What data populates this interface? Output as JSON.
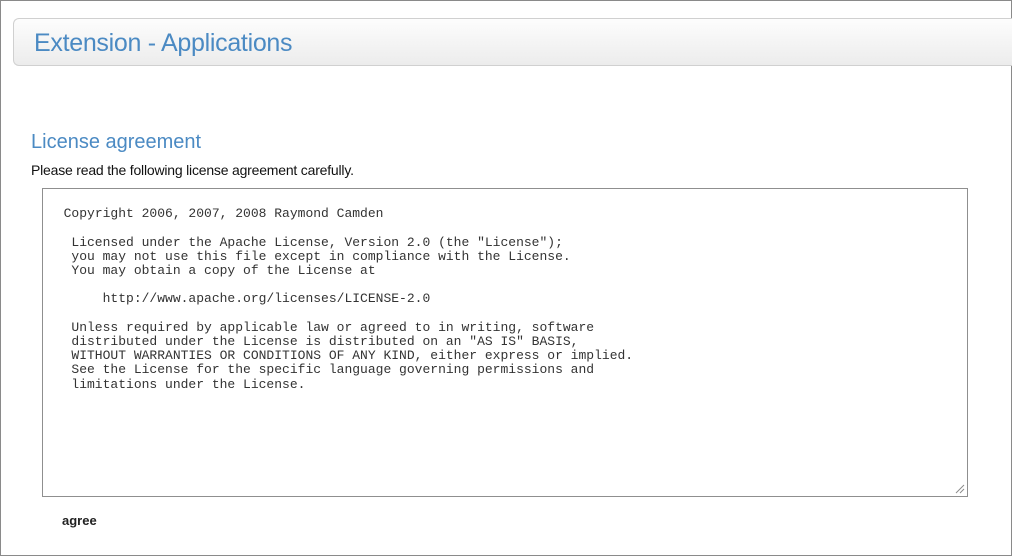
{
  "header": {
    "title": "Extension - Applications"
  },
  "license": {
    "heading": "License agreement",
    "instructions": "Please read the following license agreement carefully.",
    "text": "Copyright 2006, 2007, 2008 Raymond Camden\n\n   Licensed under the Apache License, Version 2.0 (the \"License\");\n   you may not use this file except in compliance with the License.\n   You may obtain a copy of the License at\n\n       http://www.apache.org/licenses/LICENSE-2.0\n\n   Unless required by applicable law or agreed to in writing, software\n   distributed under the License is distributed on an \"AS IS\" BASIS,\n   WITHOUT WARRANTIES OR CONDITIONS OF ANY KIND, either express or implied.\n   See the License for the specific language governing permissions and\n   limitations under the License.",
    "agree_label": "agree"
  },
  "colors": {
    "accent": "#4b8ac3",
    "text": "#111111"
  },
  "icons": {
    "resize_grip": "resize-grip-icon"
  }
}
